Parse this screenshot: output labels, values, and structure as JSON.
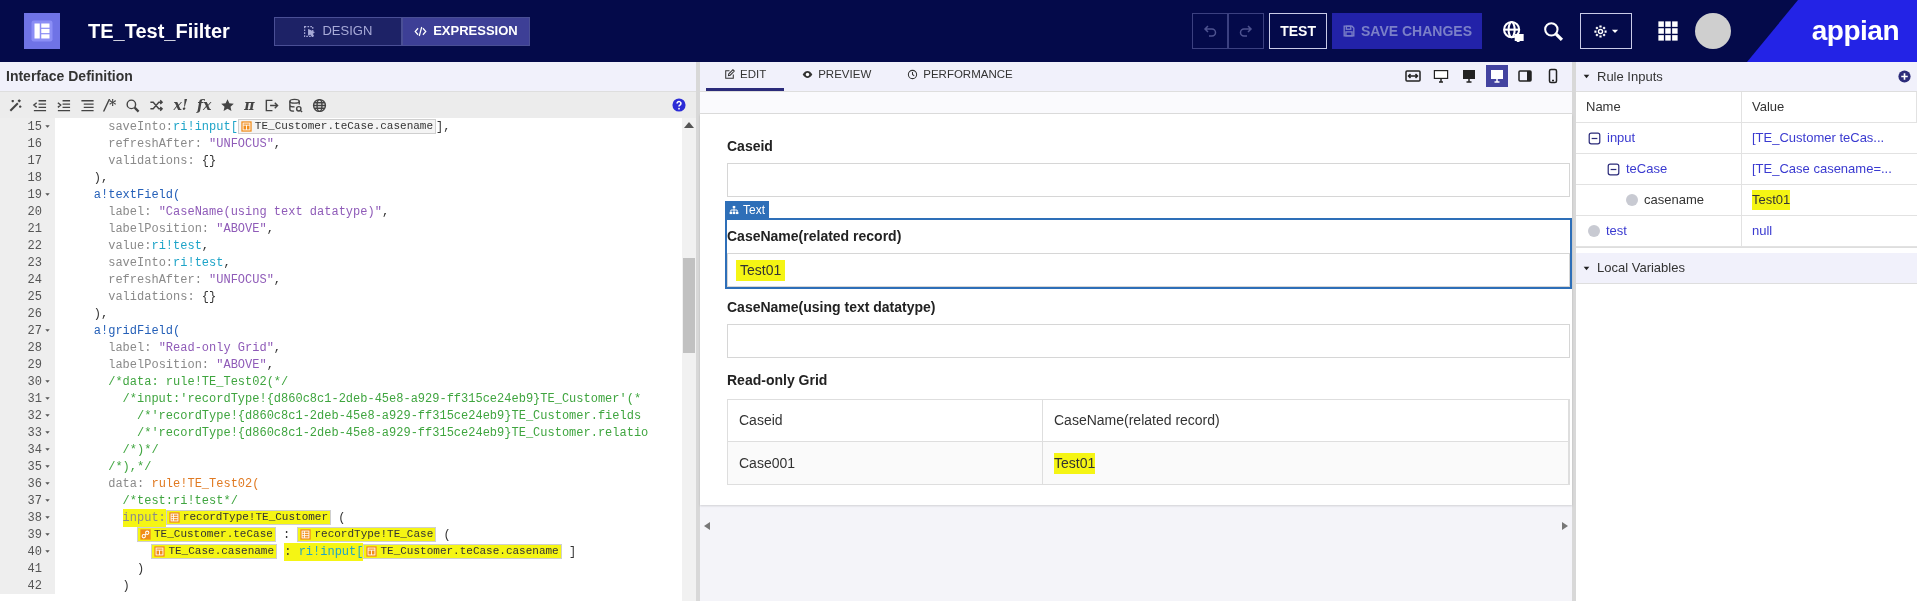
{
  "header": {
    "title": "TE_Test_Fiilter",
    "modes": [
      {
        "label": "DESIGN",
        "selected": false
      },
      {
        "label": "EXPRESSION",
        "selected": true
      }
    ],
    "history": [
      {
        "disabled": true
      },
      {
        "disabled": true
      }
    ],
    "test_button": "TEST",
    "save_button": {
      "label": "SAVE CHANGES",
      "disabled": true
    },
    "logo": "appian"
  },
  "editor": {
    "title": "Interface Definition",
    "toolbar": [
      {
        "kind": "icon"
      },
      {
        "kind": "icon"
      },
      {
        "kind": "icon"
      },
      {
        "kind": "icon"
      },
      {
        "kind": "glyph",
        "text": "/*"
      },
      {
        "kind": "icon"
      },
      {
        "kind": "icon"
      },
      {
        "kind": "glyph",
        "text": "x!"
      },
      {
        "kind": "glyph",
        "text": "fx"
      },
      {
        "kind": "icon"
      },
      {
        "kind": "glyph",
        "text": "π"
      },
      {
        "kind": "icon"
      },
      {
        "kind": "icon"
      },
      {
        "kind": "icon"
      }
    ],
    "lines": [
      {
        "number": "15",
        "fold": true,
        "tokens": [
          {
            "kind": "key",
            "text": "      saveInto:"
          },
          {
            "kind": "ri",
            "text": "ri!input["
          },
          {
            "kind": "field",
            "text": "TE_Customer.teCase.casename"
          },
          {
            "kind": "plain",
            "text": "],"
          }
        ]
      },
      {
        "number": "16",
        "fold": false,
        "tokens": [
          {
            "kind": "key",
            "text": "      refreshAfter:"
          },
          {
            "kind": "str",
            "text": " \"UNFOCUS\""
          },
          {
            "kind": "plain",
            "text": ","
          }
        ]
      },
      {
        "number": "17",
        "fold": false,
        "tokens": [
          {
            "kind": "key",
            "text": "      validations:"
          },
          {
            "kind": "plain",
            "text": " {}"
          }
        ]
      },
      {
        "number": "18",
        "fold": false,
        "tokens": [
          {
            "kind": "plain",
            "text": "    ),"
          }
        ]
      },
      {
        "number": "19",
        "fold": true,
        "tokens": [
          {
            "kind": "func",
            "text": "    a!textField("
          }
        ]
      },
      {
        "number": "20",
        "fold": false,
        "tokens": [
          {
            "kind": "key",
            "text": "      label:"
          },
          {
            "kind": "str",
            "text": " \"CaseName(using text datatype)\""
          },
          {
            "kind": "plain",
            "text": ","
          }
        ]
      },
      {
        "number": "21",
        "fold": false,
        "tokens": [
          {
            "kind": "key",
            "text": "      labelPosition:"
          },
          {
            "kind": "str",
            "text": " \"ABOVE\""
          },
          {
            "kind": "plain",
            "text": ","
          }
        ]
      },
      {
        "number": "22",
        "fold": false,
        "tokens": [
          {
            "kind": "key",
            "text": "      value:"
          },
          {
            "kind": "ri",
            "text": "ri!test"
          },
          {
            "kind": "plain",
            "text": ","
          }
        ]
      },
      {
        "number": "23",
        "fold": false,
        "tokens": [
          {
            "kind": "key",
            "text": "      saveInto:"
          },
          {
            "kind": "ri",
            "text": "ri!test"
          },
          {
            "kind": "plain",
            "text": ","
          }
        ]
      },
      {
        "number": "24",
        "fold": false,
        "tokens": [
          {
            "kind": "key",
            "text": "      refreshAfter:"
          },
          {
            "kind": "str",
            "text": " \"UNFOCUS\""
          },
          {
            "kind": "plain",
            "text": ","
          }
        ]
      },
      {
        "number": "25",
        "fold": false,
        "tokens": [
          {
            "kind": "key",
            "text": "      validations:"
          },
          {
            "kind": "plain",
            "text": " {}"
          }
        ]
      },
      {
        "number": "26",
        "fold": false,
        "tokens": [
          {
            "kind": "plain",
            "text": "    ),"
          }
        ]
      },
      {
        "number": "27",
        "fold": true,
        "tokens": [
          {
            "kind": "func",
            "text": "    a!gridField("
          }
        ]
      },
      {
        "number": "28",
        "fold": false,
        "tokens": [
          {
            "kind": "key",
            "text": "      label:"
          },
          {
            "kind": "str",
            "text": " \"Read-only Grid\""
          },
          {
            "kind": "plain",
            "text": ","
          }
        ]
      },
      {
        "number": "29",
        "fold": false,
        "tokens": [
          {
            "kind": "key",
            "text": "      labelPosition:"
          },
          {
            "kind": "str",
            "text": " \"ABOVE\""
          },
          {
            "kind": "plain",
            "text": ","
          }
        ]
      },
      {
        "number": "30",
        "fold": true,
        "tokens": [
          {
            "kind": "comment",
            "text": "      /*data: rule!TE_Test02(*/"
          }
        ]
      },
      {
        "number": "31",
        "fold": true,
        "tokens": [
          {
            "kind": "comment",
            "text": "        /*input:'recordType!{d860c8c1-2deb-45e8-a929-ff315ce24eb9}TE_Customer'(*"
          }
        ]
      },
      {
        "number": "32",
        "fold": true,
        "tokens": [
          {
            "kind": "comment",
            "text": "          /*'recordType!{d860c8c1-2deb-45e8-a929-ff315ce24eb9}TE_Customer.fields"
          }
        ]
      },
      {
        "number": "33",
        "fold": true,
        "tokens": [
          {
            "kind": "comment",
            "text": "          /*'recordType!{d860c8c1-2deb-45e8-a929-ff315ce24eb9}TE_Customer.relatio"
          }
        ]
      },
      {
        "number": "34",
        "fold": true,
        "tokens": [
          {
            "kind": "comment",
            "text": "        /*)*/"
          }
        ]
      },
      {
        "number": "35",
        "fold": true,
        "tokens": [
          {
            "kind": "comment",
            "text": "      /*),*/"
          }
        ]
      },
      {
        "number": "36",
        "fold": true,
        "tokens": [
          {
            "kind": "key",
            "text": "      data:"
          },
          {
            "kind": "rule",
            "text": " rule!TE_Test02("
          }
        ]
      },
      {
        "number": "37",
        "fold": true,
        "tokens": [
          {
            "kind": "comment",
            "text": "        /*test:ri!test*/"
          }
        ]
      },
      {
        "number": "38",
        "fold": true,
        "tokens": [
          {
            "kind": "key",
            "text": "        input:",
            "highlight": true
          },
          {
            "kind": "record",
            "text": "recordType!TE_Customer",
            "highlight": true
          },
          {
            "kind": "plain",
            "text": " ("
          }
        ]
      },
      {
        "number": "39",
        "fold": true,
        "tokens": [
          {
            "kind": "relationship",
            "text": "          TE_Customer.teCase",
            "highlight": true
          },
          {
            "kind": "plain",
            "text": " : "
          },
          {
            "kind": "record",
            "text": "recordType!TE_Case",
            "highlight": true
          },
          {
            "kind": "plain",
            "text": " ("
          }
        ]
      },
      {
        "number": "40",
        "fold": true,
        "tokens": [
          {
            "kind": "field",
            "text": "            TE_Case.casename",
            "highlight": true
          },
          {
            "kind": "plain",
            "text": " : ",
            "highlight": true
          },
          {
            "kind": "ri",
            "text": "ri!input[",
            "highlight": true
          },
          {
            "kind": "field",
            "text": "TE_Customer.teCase.casename",
            "highlight": true
          },
          {
            "kind": "plain",
            "text": " ]"
          }
        ]
      },
      {
        "number": "41",
        "fold": false,
        "tokens": [
          {
            "kind": "plain",
            "text": "          )"
          }
        ]
      },
      {
        "number": "42",
        "fold": false,
        "tokens": [
          {
            "kind": "plain",
            "text": "        )"
          }
        ]
      }
    ]
  },
  "preview": {
    "tabs": [
      {
        "label": "EDIT",
        "selected": true
      },
      {
        "label": "PREVIEW",
        "selected": false
      },
      {
        "label": "PERFORMANCE",
        "selected": false
      }
    ],
    "devices": [
      {
        "selected": false
      },
      {
        "selected": false
      },
      {
        "selected": false
      },
      {
        "selected": true
      },
      {
        "selected": false
      },
      {
        "selected": false
      }
    ],
    "components": [
      {
        "kind": "text_field",
        "label": "Caseid",
        "selected": false
      },
      {
        "kind": "text_field",
        "label": "CaseName(related record)",
        "value": "Test01",
        "highlighted": true,
        "selected": true,
        "selection_tag": "Text"
      },
      {
        "kind": "text_field",
        "label": "CaseName(using text datatype)",
        "selected": false
      },
      {
        "kind": "grid",
        "label": "Read-only Grid",
        "selected": false,
        "columns": [
          "Caseid",
          "CaseName(related record)"
        ],
        "rows": [
          [
            {
              "text": "Case001",
              "highlighted": false
            },
            {
              "text": "Test01",
              "highlighted": true
            }
          ]
        ]
      }
    ]
  },
  "rule_inputs": {
    "title": "Rule Inputs",
    "expanded": true,
    "columns": [
      "Name",
      "Value"
    ],
    "rows": [
      {
        "name": "input",
        "value": "[TE_Customer teCas...",
        "linked": true,
        "expanded": true,
        "children": [
          {
            "name": "teCase",
            "value": "[TE_Case casename=...",
            "linked": true,
            "expanded": true,
            "children": [
              {
                "name": "casename",
                "value": "Test01",
                "linked": false,
                "highlighted": true
              }
            ]
          }
        ]
      },
      {
        "name": "test",
        "value": "null",
        "linked": true
      }
    ]
  },
  "local_variables": {
    "title": "Local Variables",
    "expanded": true
  }
}
